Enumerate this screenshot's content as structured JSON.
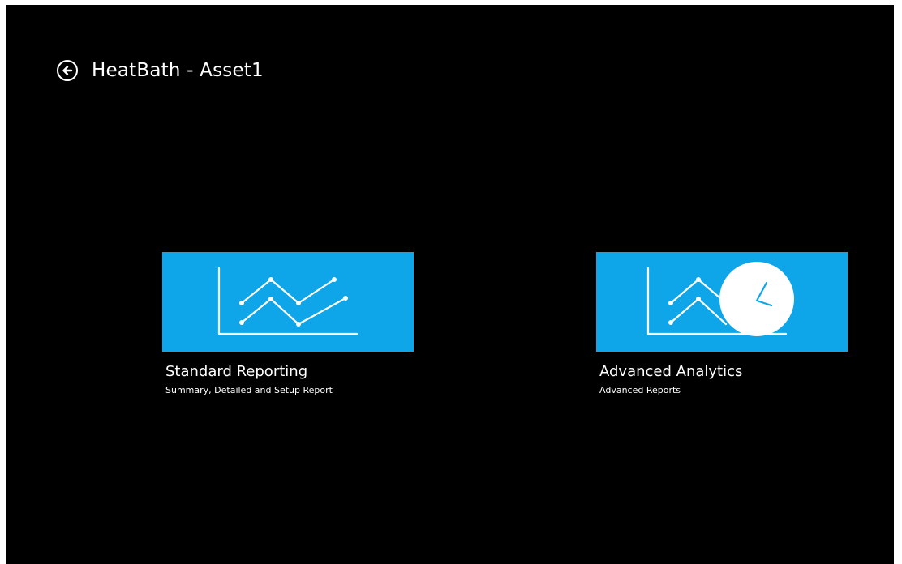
{
  "header": {
    "title": "HeatBath - Asset1",
    "back_icon": "back-arrow-icon"
  },
  "tiles": [
    {
      "title": "Standard Reporting",
      "subtitle": "Summary, Detailed and Setup Report",
      "icon": "line-chart-icon",
      "color": "#0ea5e9"
    },
    {
      "title": "Advanced Analytics",
      "subtitle": "Advanced Reports",
      "icon": "chart-clock-icon",
      "color": "#0ea5e9"
    }
  ],
  "colors": {
    "background": "#000000",
    "text": "#ffffff",
    "tile": "#0ea5e9"
  }
}
